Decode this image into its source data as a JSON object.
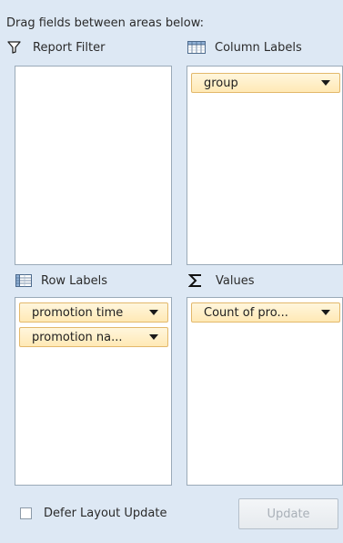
{
  "instruction": "Drag fields between areas below:",
  "areas": {
    "report_filter": {
      "label": "Report Filter",
      "icon": "filter-icon",
      "fields": []
    },
    "column_labels": {
      "label": "Column Labels",
      "icon": "grid-columns-icon",
      "fields": [
        "group"
      ]
    },
    "row_labels": {
      "label": "Row Labels",
      "icon": "grid-rows-icon",
      "fields": [
        "promotion time",
        "promotion na..."
      ]
    },
    "values": {
      "label": "Values",
      "icon": "sigma-icon",
      "fields": [
        "Count of  pro..."
      ]
    }
  },
  "defer_layout_update": {
    "label": "Defer Layout Update",
    "checked": false
  },
  "update_button": {
    "label": "Update",
    "enabled": false
  },
  "colors": {
    "panel_background": "#dde8f4",
    "drop_area_background": "#ffffff",
    "field_pill_fill": "#ffe9b5",
    "field_pill_border": "#e3b86b",
    "disabled_text": "#a9b0b8"
  }
}
